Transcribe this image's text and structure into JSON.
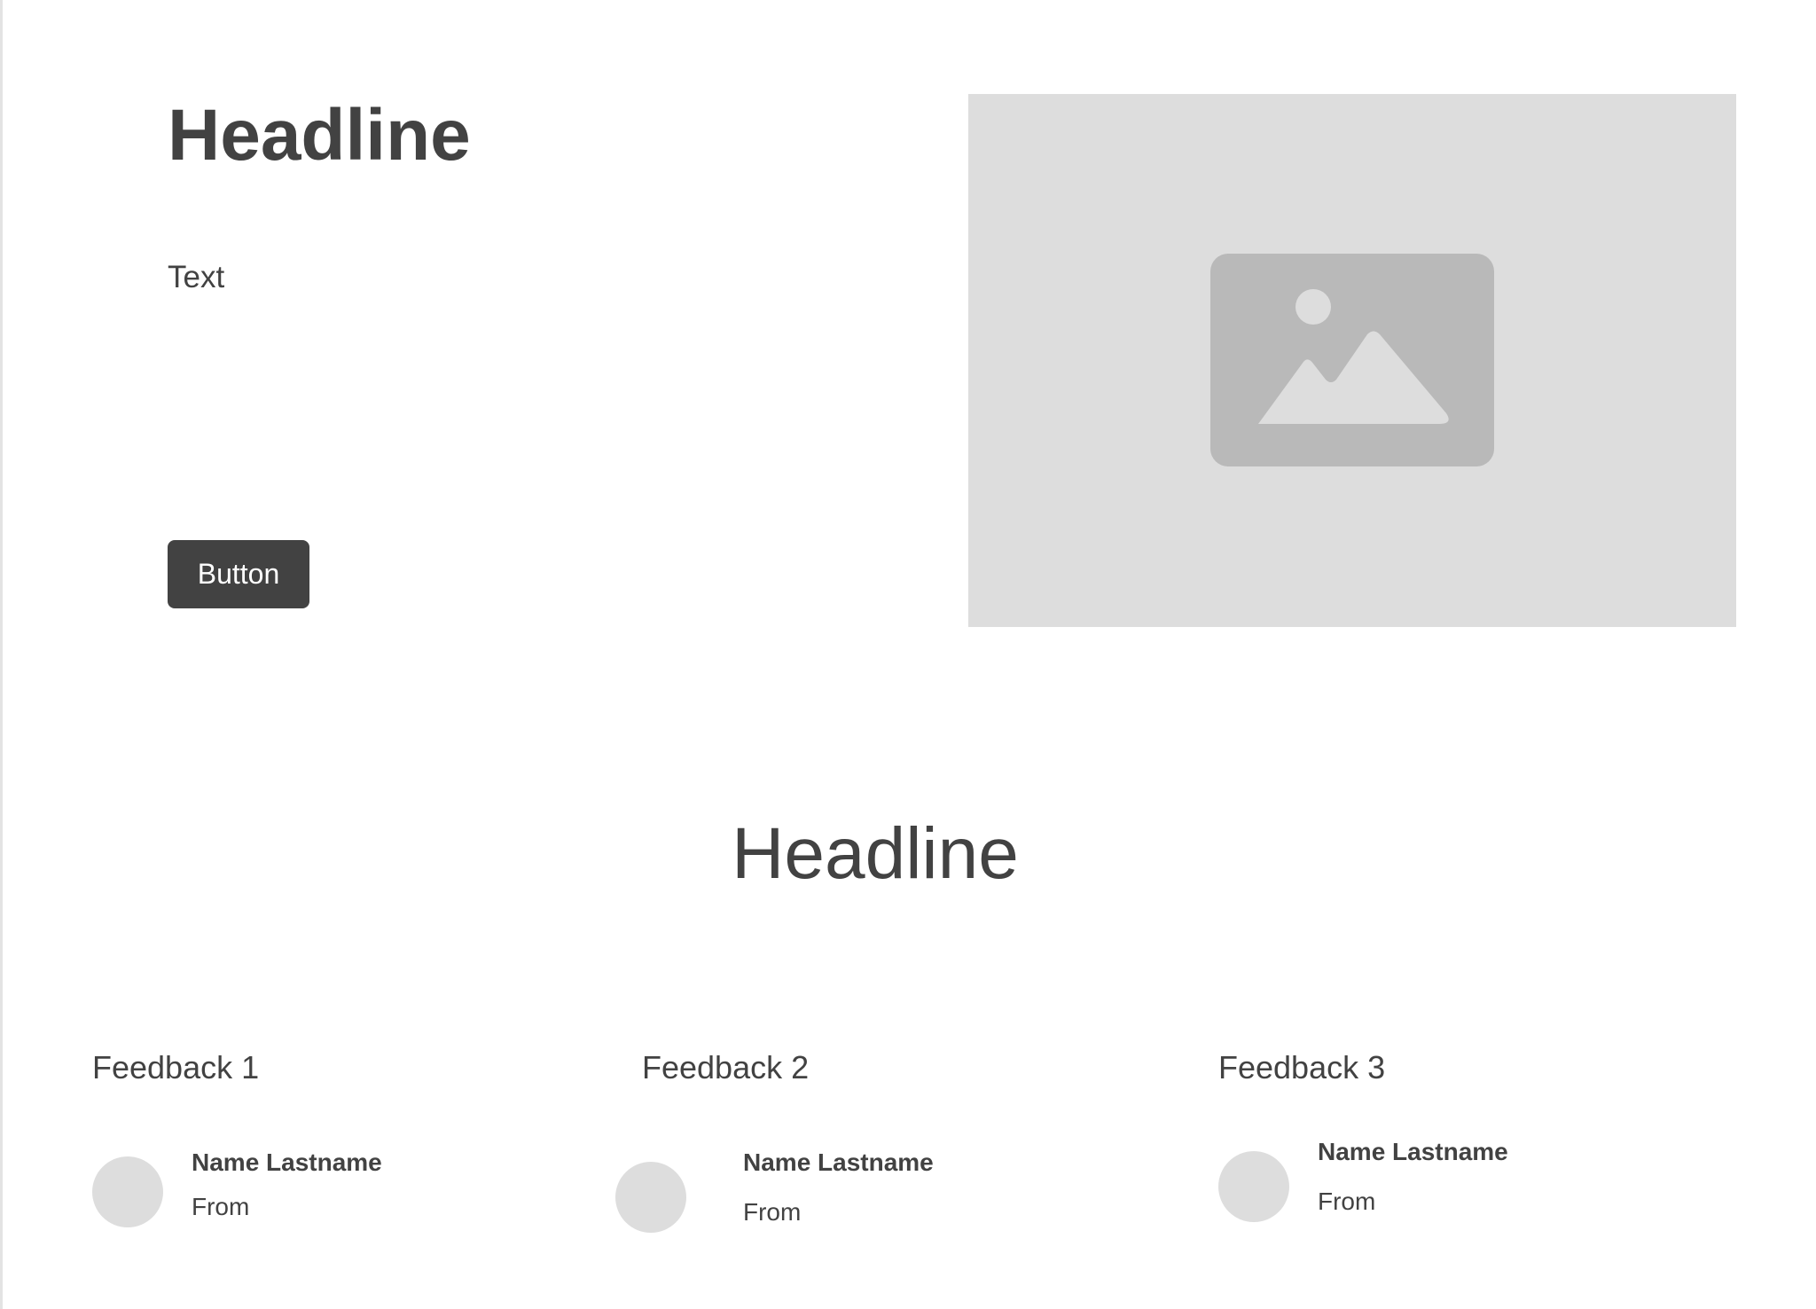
{
  "hero": {
    "headline": "Headline",
    "text": "Text",
    "button_label": "Button",
    "image_icon": "image-icon"
  },
  "section": {
    "headline": "Headline"
  },
  "feedback": [
    {
      "title": "Feedback 1",
      "name": "Name Lastname",
      "from": "From"
    },
    {
      "title": "Feedback 2",
      "name": "Name Lastname",
      "from": "From"
    },
    {
      "title": "Feedback 3",
      "name": "Name Lastname",
      "from": "From"
    }
  ],
  "colors": {
    "text": "#424242",
    "button_background": "#424242",
    "placeholder_background": "#dddddd",
    "icon_fill": "#b9b9b9"
  }
}
